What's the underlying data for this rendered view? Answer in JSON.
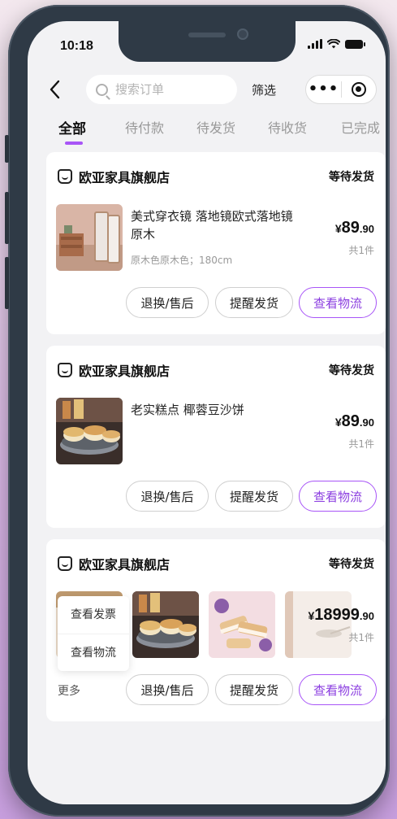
{
  "status_bar": {
    "time": "10:18"
  },
  "header": {
    "search_placeholder": "搜索订单",
    "filter_label": "筛选",
    "more_label": "•••"
  },
  "tabs": [
    {
      "label": "全部",
      "active": true
    },
    {
      "label": "待付款",
      "active": false
    },
    {
      "label": "待发货",
      "active": false
    },
    {
      "label": "待收货",
      "active": false
    },
    {
      "label": "已完成",
      "active": false
    }
  ],
  "accent_color": "#a855f7",
  "orders": [
    {
      "shop_name": "欧亚家具旗舰店",
      "status": "等待发货",
      "product_title": "美式穿衣镜 落地镜欧式落地镜 原木",
      "sku": "原木色原木色；180cm",
      "price_currency": "¥",
      "price_int": "89",
      "price_dec": ".90",
      "quantity": "共1件",
      "actions": [
        "退换/售后",
        "提醒发货",
        "查看物流"
      ]
    },
    {
      "shop_name": "欧亚家具旗舰店",
      "status": "等待发货",
      "product_title": "老实糕点 椰蓉豆沙饼",
      "price_currency": "¥",
      "price_int": "89",
      "price_dec": ".90",
      "quantity": "共1件",
      "actions": [
        "退换/售后",
        "提醒发货",
        "查看物流"
      ]
    },
    {
      "shop_name": "欧亚家具旗舰店",
      "status": "等待发货",
      "price_currency": "¥",
      "price_int": "18999",
      "price_dec": ".90",
      "quantity": "共1件",
      "more_label": "更多",
      "popup_items": [
        "查看发票",
        "查看物流"
      ],
      "actions": [
        "退换/售后",
        "提醒发货",
        "查看物流"
      ]
    }
  ]
}
